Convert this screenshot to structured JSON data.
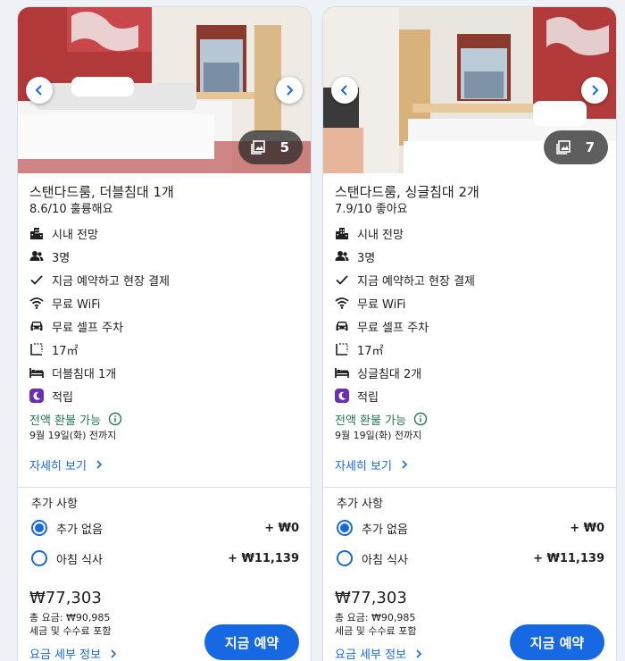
{
  "colors": {
    "accent": "#1668e3",
    "refund_green": "#227950",
    "reward_purple": "#6b2fb3"
  },
  "rooms": [
    {
      "photo_count": "5",
      "name": "스탠다드룸, 더블침대 1개",
      "rating": "8.6/10 훌륭해요",
      "features": {
        "view": "시내 전망",
        "guests": "3명",
        "payment": "지금 예약하고 현장 결제",
        "wifi": "무료 WiFi",
        "parking": "무료 셀프 주차",
        "size": "17㎡",
        "bed": "더블침대 1개",
        "reward": "적립"
      },
      "refund": "전액 환불 가능",
      "deadline": "9월 19일(화) 전까지",
      "details_link": "자세히 보기",
      "extras_title": "추가 사항",
      "options": [
        {
          "label": "추가 없음",
          "price": "+ ₩0",
          "selected": true
        },
        {
          "label": "아침 식사",
          "price": "+ ₩11,139",
          "selected": false
        }
      ],
      "price": "₩77,303",
      "total": "총 요금: ₩90,985",
      "tax": "세금 및 수수료 포함",
      "price_details": "요금 세부 정보",
      "reserve_label": "지금 예약"
    },
    {
      "photo_count": "7",
      "name": "스탠다드룸, 싱글침대 2개",
      "rating": "7.9/10 좋아요",
      "features": {
        "view": "시내 전망",
        "guests": "3명",
        "payment": "지금 예약하고 현장 결제",
        "wifi": "무료 WiFi",
        "parking": "무료 셀프 주차",
        "size": "17㎡",
        "bed": "싱글침대 2개",
        "reward": "적립"
      },
      "refund": "전액 환불 가능",
      "deadline": "9월 19일(화) 전까지",
      "details_link": "자세히 보기",
      "extras_title": "추가 사항",
      "options": [
        {
          "label": "추가 없음",
          "price": "+ ₩0",
          "selected": true
        },
        {
          "label": "아침 식사",
          "price": "+ ₩11,139",
          "selected": false
        }
      ],
      "price": "₩77,303",
      "total": "총 요금: ₩90,985",
      "tax": "세금 및 수수료 포함",
      "price_details": "요금 세부 정보",
      "reserve_label": "지금 예약"
    }
  ]
}
